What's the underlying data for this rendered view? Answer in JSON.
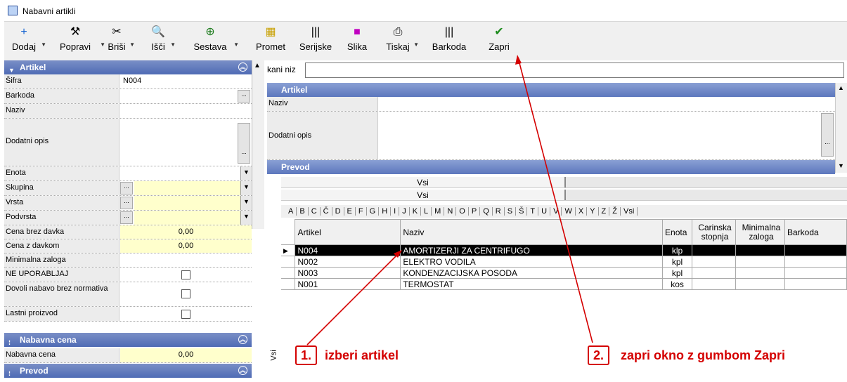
{
  "window": {
    "title": "Nabavni artikli"
  },
  "toolbar": [
    {
      "label": "Dodaj",
      "icon": "plus-icon",
      "glyph": "+",
      "color": "#1060d0"
    },
    {
      "label": "Popravi",
      "icon": "hammer-icon",
      "glyph": "⚒",
      "color": "#000"
    },
    {
      "label": "Briši",
      "icon": "scissors-icon",
      "glyph": "✂",
      "color": "#000"
    },
    {
      "label": "Išči",
      "icon": "search-icon",
      "glyph": "🔍",
      "color": "#1a3fa0"
    },
    {
      "label": "Sestava",
      "icon": "composition-icon",
      "glyph": "⊕",
      "color": "#1a7a1a"
    },
    {
      "label": "Promet",
      "icon": "traffic-icon",
      "glyph": "▦",
      "color": "#c8a000"
    },
    {
      "label": "Serijske",
      "icon": "barcode-icon",
      "glyph": "|||",
      "color": "#000"
    },
    {
      "label": "Slika",
      "icon": "image-icon",
      "glyph": "■",
      "color": "#c000c0"
    },
    {
      "label": "Tiskaj",
      "icon": "printer-icon",
      "glyph": "⎙",
      "color": "#000"
    },
    {
      "label": "Barkoda",
      "icon": "barcode-icon",
      "glyph": "|||",
      "color": "#000"
    },
    {
      "label": "Zapri",
      "icon": "checkmark-icon",
      "glyph": "✔",
      "color": "#1a8a1a"
    }
  ],
  "left": {
    "sec_artikel": "Artikel",
    "sec_nabavna": "Nabavna cena",
    "sec_prevod": "Prevod",
    "fields": {
      "sifra": {
        "label": "Šifra",
        "value": "N004"
      },
      "barkoda": {
        "label": "Barkoda",
        "value": ""
      },
      "naziv": {
        "label": "Naziv",
        "value": ""
      },
      "dodatni_opis": {
        "label": "Dodatni opis",
        "value": ""
      },
      "enota": {
        "label": "Enota",
        "value": ""
      },
      "skupina": {
        "label": "Skupina",
        "value": ""
      },
      "vrsta": {
        "label": "Vrsta",
        "value": ""
      },
      "podvrsta": {
        "label": "Podvrsta",
        "value": ""
      },
      "cena_brez": {
        "label": "Cena brez davka",
        "value": "0,00"
      },
      "cena_z": {
        "label": "Cena z davkom",
        "value": "0,00"
      },
      "min_zaloga": {
        "label": "Minimalna zaloga",
        "value": ""
      },
      "ne_uporabljaj": {
        "label": "NE UPORABLJAJ"
      },
      "dovoli": {
        "label": "Dovoli nabavo brez normativa"
      },
      "lastni": {
        "label": "Lastni proizvod"
      },
      "nabavna_cena": {
        "label": "Nabavna cena",
        "value": "0,00"
      }
    }
  },
  "right": {
    "search_label": "kani niz",
    "sec_artikel": "Artikel",
    "naziv_label": "Naziv",
    "opis_label": "Dodatni opis",
    "sec_prevod": "Prevod",
    "filter1": "Vsi",
    "filter2": "Vsi",
    "alphabet": [
      "A",
      "B",
      "C",
      "Č",
      "D",
      "E",
      "F",
      "G",
      "H",
      "I",
      "J",
      "K",
      "L",
      "M",
      "N",
      "O",
      "P",
      "Q",
      "R",
      "S",
      "Š",
      "T",
      "U",
      "V",
      "W",
      "X",
      "Y",
      "Z",
      "Ž",
      "Vsi"
    ],
    "side_tab": "Vsi",
    "columns": [
      "Artikel",
      "Naziv",
      "Enota",
      "Carinska stopnja",
      "Minimalna zaloga",
      "Barkoda"
    ],
    "rows": [
      {
        "artikel": "N004",
        "naziv": "AMORTIZERJI ZA CENTRIFUGO",
        "enota": "klp",
        "selected": true
      },
      {
        "artikel": "N002",
        "naziv": "ELEKTRO VODILA",
        "enota": "kpl",
        "selected": false
      },
      {
        "artikel": "N003",
        "naziv": "KONDENZACIJSKA POSODA",
        "enota": "kpl",
        "selected": false
      },
      {
        "artikel": "N001",
        "naziv": "TERMOSTAT",
        "enota": "kos",
        "selected": false
      }
    ]
  },
  "annotations": {
    "a1_num": "1.",
    "a1_text": "izberi artikel",
    "a2_num": "2.",
    "a2_text": "zapri okno z gumbom Zapri",
    "color": "#d40000",
    "highlight": "#ffff33"
  }
}
